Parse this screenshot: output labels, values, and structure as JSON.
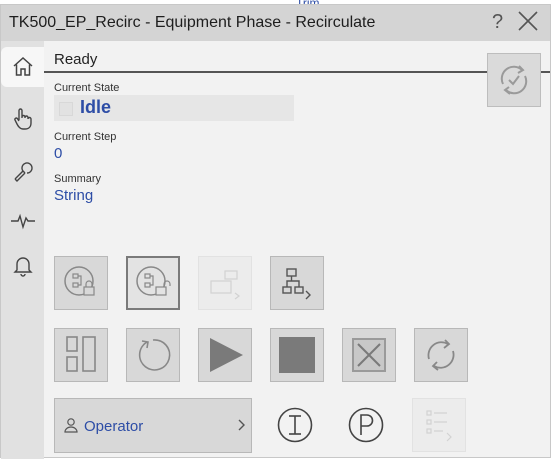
{
  "window": {
    "title": "TK500_EP_Recirc - Equipment Phase - Recirculate",
    "help_glyph": "?",
    "top_cut_text": "Trim"
  },
  "sidebar": [
    {
      "name": "home",
      "icon": "home-icon",
      "active": true
    },
    {
      "name": "manual",
      "icon": "hand-pointer-icon"
    },
    {
      "name": "maintenance",
      "icon": "wrench-icon"
    },
    {
      "name": "trend",
      "icon": "pulse-icon"
    },
    {
      "name": "alarms",
      "icon": "bell-icon"
    }
  ],
  "status": {
    "text": "Ready"
  },
  "fields": {
    "current_state_label": "Current State",
    "current_state_value": "Idle",
    "current_step_label": "Current Step",
    "current_step_value": "0",
    "summary_label": "Summary",
    "summary_value": "String"
  },
  "operator": {
    "label": "Operator"
  },
  "icons": [
    "refresh-icon",
    "lock-tree-icon",
    "unlock-tree-icon",
    "transfer-icon",
    "hierarchy-icon",
    "pause-bars-icon",
    "reset-icon",
    "play-icon",
    "stop-icon",
    "abort-icon",
    "restart-icon",
    "user-icon",
    "chevron-right-icon",
    "info-circle-icon",
    "p-circle-icon",
    "list-icon"
  ],
  "colors": {
    "accent": "#2d4da6",
    "title_bar": "#d4d4d4",
    "button_bg": "#d8d8d8"
  }
}
